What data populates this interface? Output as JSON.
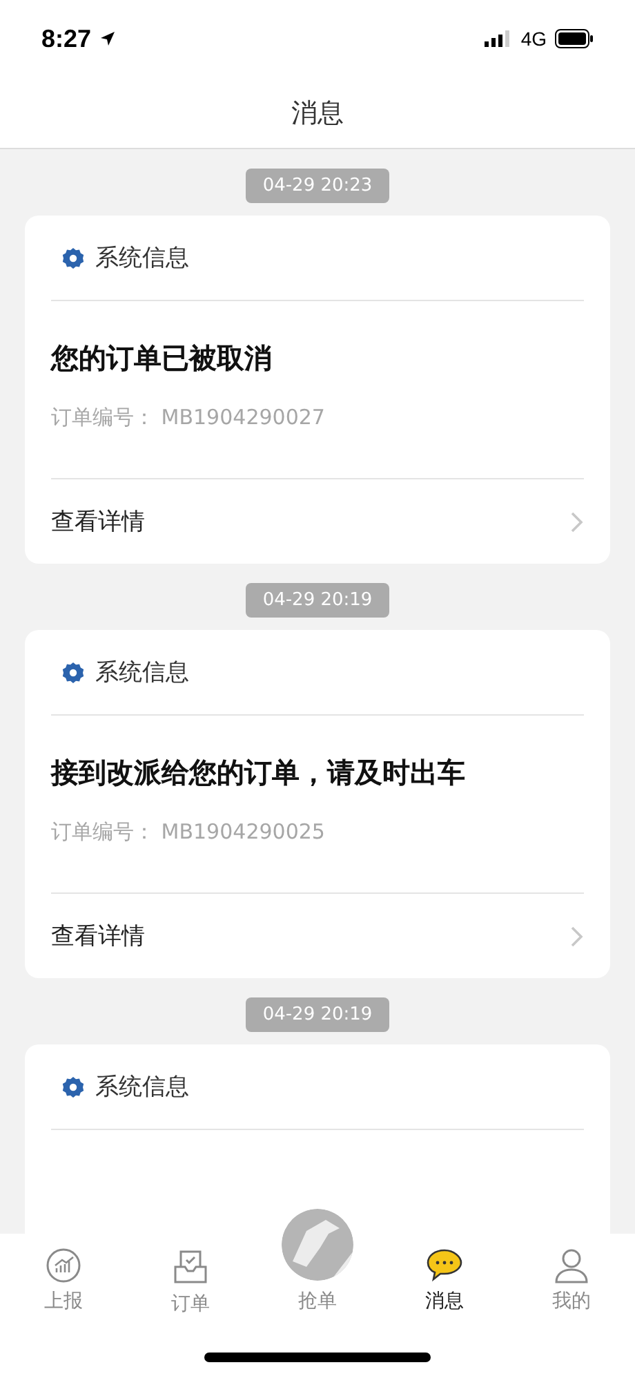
{
  "status_bar": {
    "time": "8:27",
    "network": "4G"
  },
  "header": {
    "title": "消息"
  },
  "messages": [
    {
      "time": "04-29 20:23",
      "category": "系统信息",
      "title": "您的订单已被取消",
      "order_label": "订单编号：",
      "order_no": "MB1904290027",
      "action": "查看详情"
    },
    {
      "time": "04-29 20:19",
      "category": "系统信息",
      "title": "接到改派给您的订单，请及时出车",
      "order_label": "订单编号：",
      "order_no": "MB1904290025",
      "action": "查看详情"
    },
    {
      "time": "04-29 20:19",
      "category": "系统信息"
    }
  ],
  "tab_bar": [
    {
      "kind": "report",
      "label": "上报",
      "selected": false
    },
    {
      "kind": "orders",
      "label": "订单",
      "selected": false
    },
    {
      "kind": "grab",
      "label": "抢单",
      "selected": false
    },
    {
      "kind": "messages",
      "label": "消息",
      "selected": true
    },
    {
      "kind": "profile",
      "label": "我的",
      "selected": false
    }
  ]
}
